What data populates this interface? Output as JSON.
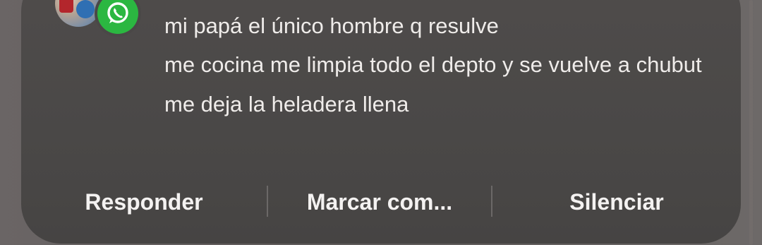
{
  "notification": {
    "app_icon": "whatsapp-icon",
    "messages": [
      "mi papá el único hombre q resulve",
      "me cocina me limpia todo el depto y se vuelve a chubut",
      "me deja la heladera llena"
    ],
    "actions": {
      "reply": "Responder",
      "mark": "Marcar com...",
      "mute": "Silenciar"
    }
  },
  "colors": {
    "card": "#4b4948",
    "whatsapp_green": "#2bb741",
    "text": "#efecea"
  }
}
